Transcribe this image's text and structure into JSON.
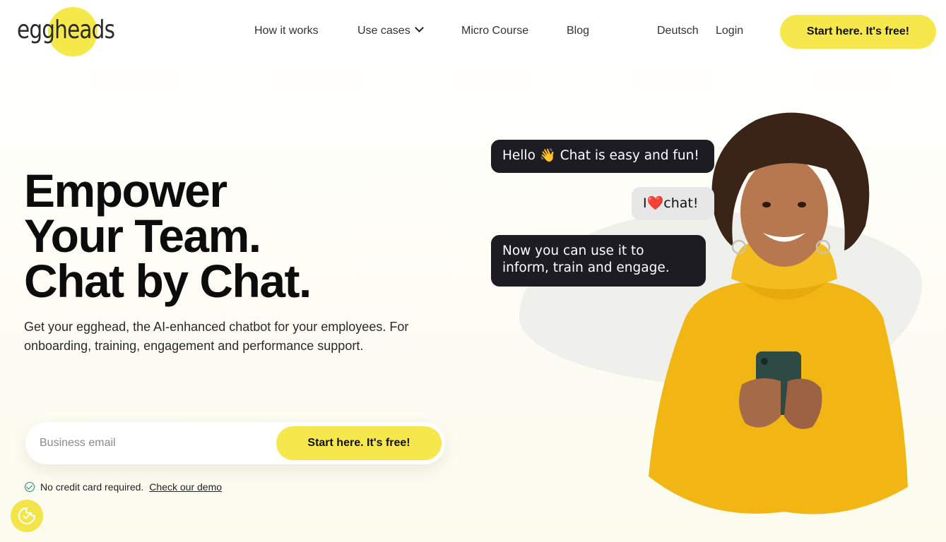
{
  "brand": {
    "logo_text": "eggheads",
    "accent_color": "#f6e84c"
  },
  "nav": {
    "items": [
      {
        "label": "How it works"
      },
      {
        "label": "Use cases",
        "has_dropdown": true
      },
      {
        "label": "Micro Course"
      },
      {
        "label": "Blog"
      }
    ],
    "language": "Deutsch",
    "login": "Login",
    "cta": "Start here. It's free!"
  },
  "hero": {
    "title_lines": [
      "Empower",
      "Your Team.",
      "Chat by Chat."
    ],
    "subtitle": "Get your egghead, the AI-enhanced chatbot for your employees. For onboarding, training, engagement and performance support.",
    "email_placeholder": "Business email",
    "email_value": "",
    "cta": "Start here. It's free!",
    "note": "No credit card required.",
    "demo_link": "Check our demo"
  },
  "chat": {
    "bubbles": [
      {
        "text_before": "Hello",
        "emoji": "👋",
        "text_after": "Chat is easy and fun!"
      },
      {
        "text_before": "I",
        "emoji": "❤️",
        "text_after": "chat!"
      },
      {
        "text": "Now you can use it to inform, train and engage."
      }
    ]
  },
  "icons": {
    "cookie": "cookie-consent-icon",
    "check": "check-circle-icon",
    "chevron": "chevron-down-icon"
  }
}
